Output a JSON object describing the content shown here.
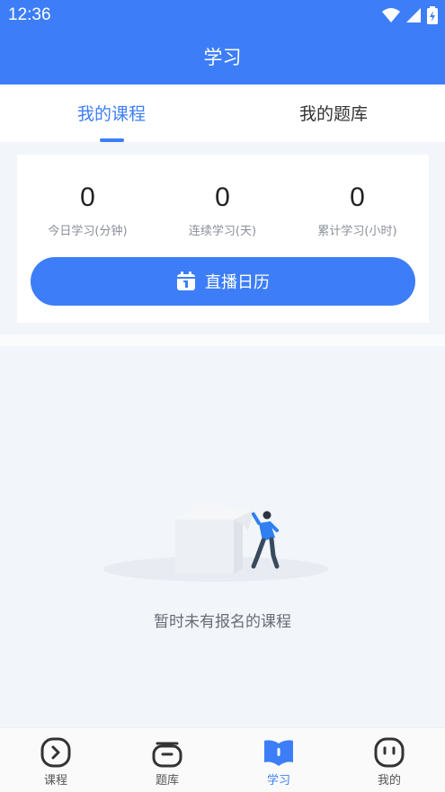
{
  "status_bar": {
    "time": "12:36"
  },
  "header": {
    "title": "学习"
  },
  "tabs": [
    {
      "label": "我的课程",
      "active": true
    },
    {
      "label": "我的题库",
      "active": false
    }
  ],
  "stats": [
    {
      "value": "0",
      "label": "今日学习(分钟)"
    },
    {
      "value": "0",
      "label": "连续学习(天)"
    },
    {
      "value": "0",
      "label": "累计学习(小时)"
    }
  ],
  "live_calendar_button": {
    "label": "直播日历",
    "icon": "calendar-icon"
  },
  "empty_state": {
    "message": "暂时未有报名的课程",
    "illustration": "empty-box-person-illustration"
  },
  "bottom_nav": [
    {
      "label": "课程",
      "icon": "course-play-icon",
      "active": false
    },
    {
      "label": "题库",
      "icon": "question-bank-icon",
      "active": false
    },
    {
      "label": "学习",
      "icon": "study-book-icon",
      "active": true
    },
    {
      "label": "我的",
      "icon": "profile-face-icon",
      "active": false
    }
  ],
  "colors": {
    "primary": "#3d7ef8",
    "background": "#f2f5fa",
    "text_muted": "#8a8f99"
  }
}
